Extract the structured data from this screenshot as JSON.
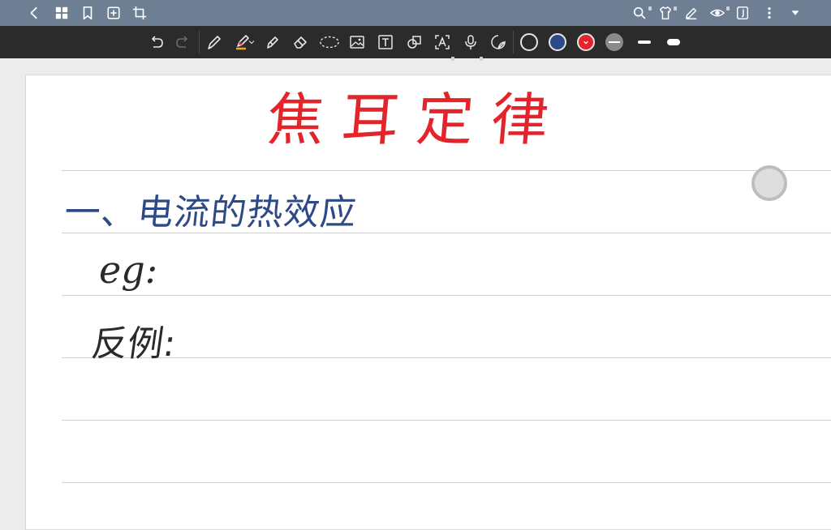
{
  "top_bar": {
    "icons": [
      "back-chevron-icon",
      "grid-icon",
      "bookmark-icon",
      "add-page-icon",
      "crop-icon",
      "search-icon",
      "shirt-icon",
      "edit-pen-icon",
      "eye-icon",
      "page-view-icon",
      "more-dots-icon",
      "dropdown-triangle-icon"
    ],
    "background": "#6f7f93"
  },
  "toolbar": {
    "tools": [
      "undo",
      "redo",
      "fountain-pen",
      "highlighter-pen",
      "marker",
      "eraser",
      "lasso",
      "image",
      "text-box",
      "shape",
      "text-recognition",
      "microphone",
      "sticker"
    ],
    "colors": [
      {
        "name": "white",
        "hex": "#ffffff"
      },
      {
        "name": "blue",
        "hex": "#2e4a86"
      },
      {
        "name": "red",
        "hex": "#e3242b",
        "selected": true
      },
      {
        "name": "gray",
        "hex": "#8a8a8a"
      }
    ],
    "background": "#2b2b2b"
  },
  "notebook": {
    "title": "焦耳定律",
    "title_color": "#e3242b",
    "heading": "一、电流的热效应",
    "heading_color": "#2e4a86",
    "line_1": "eg:",
    "line_2": "反例:",
    "ink_color": "#2a2a2a"
  }
}
